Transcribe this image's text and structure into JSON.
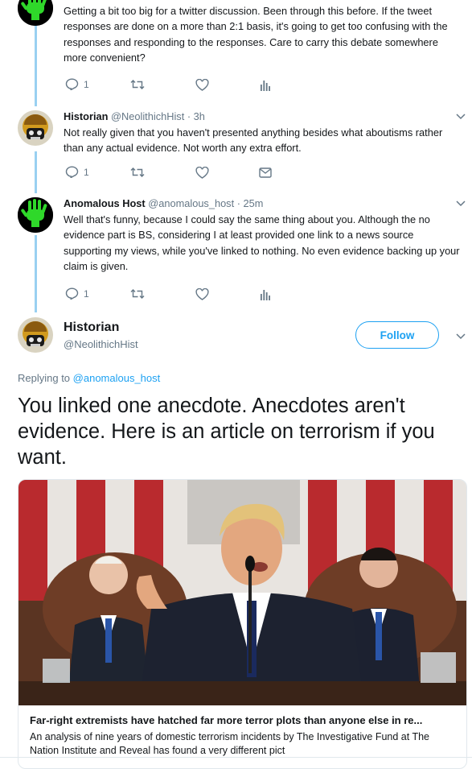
{
  "tweets": [
    {
      "text": "Getting a bit too big for a twitter discussion.  Been through this before.  If the tweet responses are done on a more than 2:1 basis, it's going to get too confusing with the responses and responding to the responses.  Care to carry this debate somewhere more convenient?",
      "reply_count": "1",
      "last_action_icon": "analytics-icon"
    },
    {
      "name": "Historian",
      "handle": "@NeolithichHist",
      "time": "3h",
      "text": "Not really given that you haven't presented anything besides what aboutisms rather than any actual evidence. Not worth any extra effort.",
      "reply_count": "1",
      "last_action_icon": "message-icon"
    },
    {
      "name": "Anomalous Host",
      "handle": "@anomalous_host",
      "time": "25m",
      "text": "Well that's funny, because I could say the same thing about you.  Although the no evidence part is BS, considering I at least provided one link to a news source supporting my views, while you've linked to nothing.  No even evidence backing up your claim is given.",
      "reply_count": "1",
      "last_action_icon": "analytics-icon"
    }
  ],
  "main_tweet": {
    "name": "Historian",
    "handle": "@NeolithichHist",
    "follow_label": "Follow",
    "replying_prefix": "Replying to ",
    "replying_to": "@anomalous_host",
    "text": "You linked one anecdote. Anecdotes aren't evidence. Here is an article on terrorism if you want.",
    "card": {
      "title": "Far-right extremists have hatched far more terror plots than anyone else in re...",
      "description": "An analysis of nine years of domestic terrorism incidents by The Investigative Fund at The Nation Institute and Reveal has found a very different pict"
    }
  },
  "colors": {
    "accent": "#1da1f2",
    "thread_line": "#99d0f1",
    "muted": "#657786",
    "alien_green": "#2fd82a"
  }
}
